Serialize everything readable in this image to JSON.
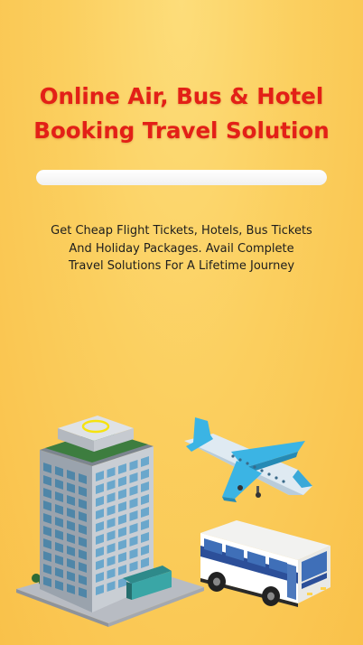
{
  "splash": {
    "title_line1": "Online Air, Bus & Hotel",
    "title_line2": "Booking Travel Solution",
    "loading_progress": 1.0,
    "description_line1": "Get Cheap Flight Tickets, Hotels, Bus Tickets",
    "description_line2": "And Holiday Packages. Avail Complete",
    "description_line3": "Travel Solutions For A Lifetime Journey"
  },
  "colors": {
    "background": "#fbcf5f",
    "title": "#e32017",
    "text": "#1d1d1d"
  },
  "illustrations": [
    "hotel-building-icon",
    "airplane-icon",
    "bus-icon"
  ]
}
